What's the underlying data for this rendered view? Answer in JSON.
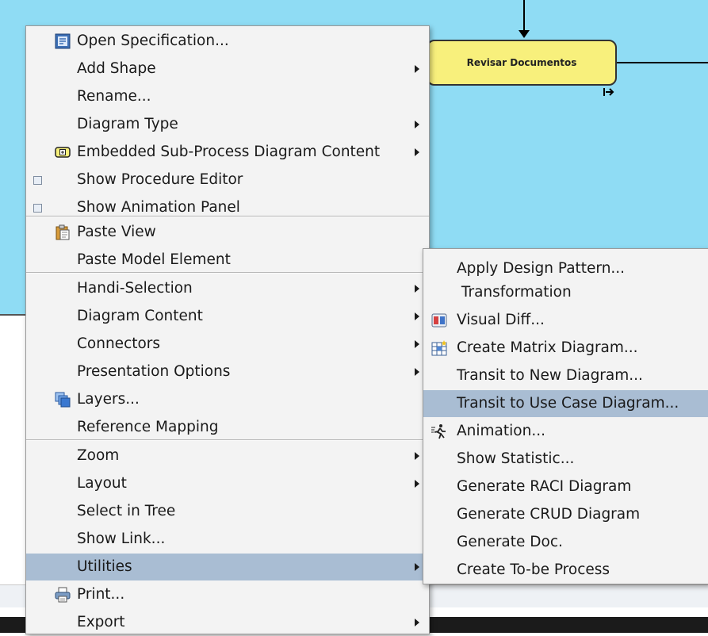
{
  "diagram": {
    "shape_label": "Revisar Documentos",
    "shape_color": "#f8f07c",
    "canvas_color": "#8fdcf4"
  },
  "main_menu": {
    "items": [
      {
        "label": "Open Specification...",
        "icon": "specification-icon"
      },
      {
        "label": "Add Shape",
        "submenu": true
      },
      {
        "label": "Rename..."
      },
      {
        "label": "Diagram Type",
        "submenu": true
      },
      {
        "label": "Embedded Sub-Process Diagram Content",
        "icon": "sub-process-icon",
        "submenu": true
      },
      {
        "label": "Show Procedure Editor",
        "checkbox": false
      },
      {
        "label": "Show Animation Panel",
        "checkbox": false
      },
      {
        "label": "Paste View",
        "icon": "clipboard-icon"
      },
      {
        "label": "Paste Model Element"
      },
      {
        "label": "Handi-Selection",
        "submenu": true
      },
      {
        "label": "Diagram Content",
        "submenu": true
      },
      {
        "label": "Connectors",
        "submenu": true
      },
      {
        "label": "Presentation Options",
        "submenu": true
      },
      {
        "label": "Layers...",
        "icon": "layers-icon"
      },
      {
        "label": "Reference Mapping"
      },
      {
        "label": "Zoom",
        "submenu": true
      },
      {
        "label": "Layout",
        "submenu": true
      },
      {
        "label": "Select in Tree"
      },
      {
        "label": "Show Link..."
      },
      {
        "label": "Utilities",
        "submenu": true,
        "highlighted": true
      },
      {
        "label": "Print...",
        "icon": "printer-icon"
      },
      {
        "label": "Export",
        "submenu": true
      }
    ]
  },
  "utilities_menu": {
    "items": [
      {
        "label": "Apply Design Pattern..."
      },
      {
        "label": " Transformation"
      },
      {
        "label": "Visual Diff...",
        "icon": "visual-diff-icon"
      },
      {
        "label": "Create Matrix Diagram...",
        "icon": "matrix-diagram-icon"
      },
      {
        "label": "Transit to New Diagram..."
      },
      {
        "label": "Transit to Use Case Diagram...",
        "highlighted": true
      },
      {
        "label": "Animation...",
        "icon": "animation-icon"
      },
      {
        "label": "Show Statistic..."
      },
      {
        "label": "Generate RACI Diagram"
      },
      {
        "label": "Generate CRUD Diagram"
      },
      {
        "label": "Generate Doc."
      },
      {
        "label": "Create To-be Process"
      }
    ]
  },
  "colors": {
    "menu_background": "#f3f3f3",
    "highlight": "#a9bdd3"
  }
}
